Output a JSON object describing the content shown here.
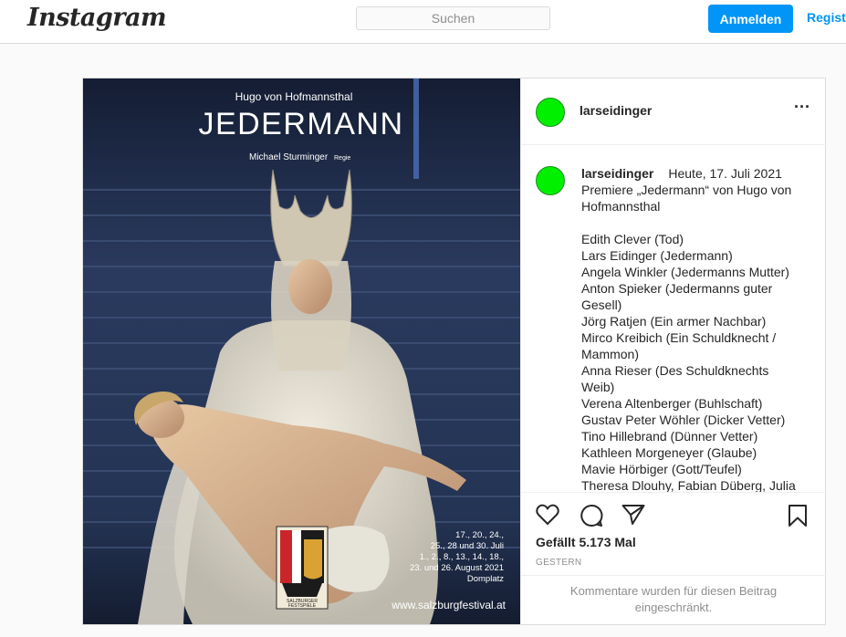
{
  "header": {
    "logo_text": "Instagram",
    "search_placeholder": "Suchen",
    "login_label": "Anmelden",
    "register_label": "Registrieren"
  },
  "poster": {
    "author": "Hugo von Hofmannsthal",
    "title": "JEDERMANN",
    "director": "Michael Sturminger",
    "director_role": "Regie",
    "dates": [
      "17., 20., 24.,",
      "25., 28 und 30. Juli",
      "1., 2., 8., 13., 14., 18.,",
      "23. und 26. August 2021",
      "Domplatz"
    ],
    "website": "www.salzburgfestival.at",
    "logo_lines": [
      "SALZBURGER",
      "FESTSPIELE"
    ]
  },
  "post": {
    "username": "larseidinger",
    "more_icon": "more-horizontal-icon",
    "caption_user": "larseidinger",
    "caption_date": "Heute, 17. Juli 2021",
    "caption_intro": "Premiere „Jedermann“ von Hugo von Hofmannsthal",
    "cast": [
      "Edith Clever (Tod)",
      "Lars Eidinger (Jedermann)",
      "Angela Winkler (Jedermanns Mutter)",
      "Anton Spieker (Jedermanns guter Gesell)",
      "Jörg Ratjen (Ein armer Nachbar)",
      "Mirco Kreibich (Ein Schuldknecht / Mammon)",
      "Anna Rieser (Des Schuldknechts Weib)",
      "Verena Altenberger (Buhlschaft)",
      "Gustav Peter Wöhler (Dicker Vetter)",
      "Tino Hillebrand (Dünner Vetter)",
      "Kathleen Morgeneyer (Glaube)",
      "Mavie Hörbiger (Gott/Teufel)",
      "Theresa Dlouhy, Fabian Düberg, Julia"
    ],
    "likes_text": "Gefällt 5.173 Mal",
    "time_text": "GESTERN",
    "comments_disabled": "Kommentare wurden für diesen Beitrag eingeschränkt."
  },
  "colors": {
    "accent": "#0095f6",
    "avatar": "#00f000"
  }
}
